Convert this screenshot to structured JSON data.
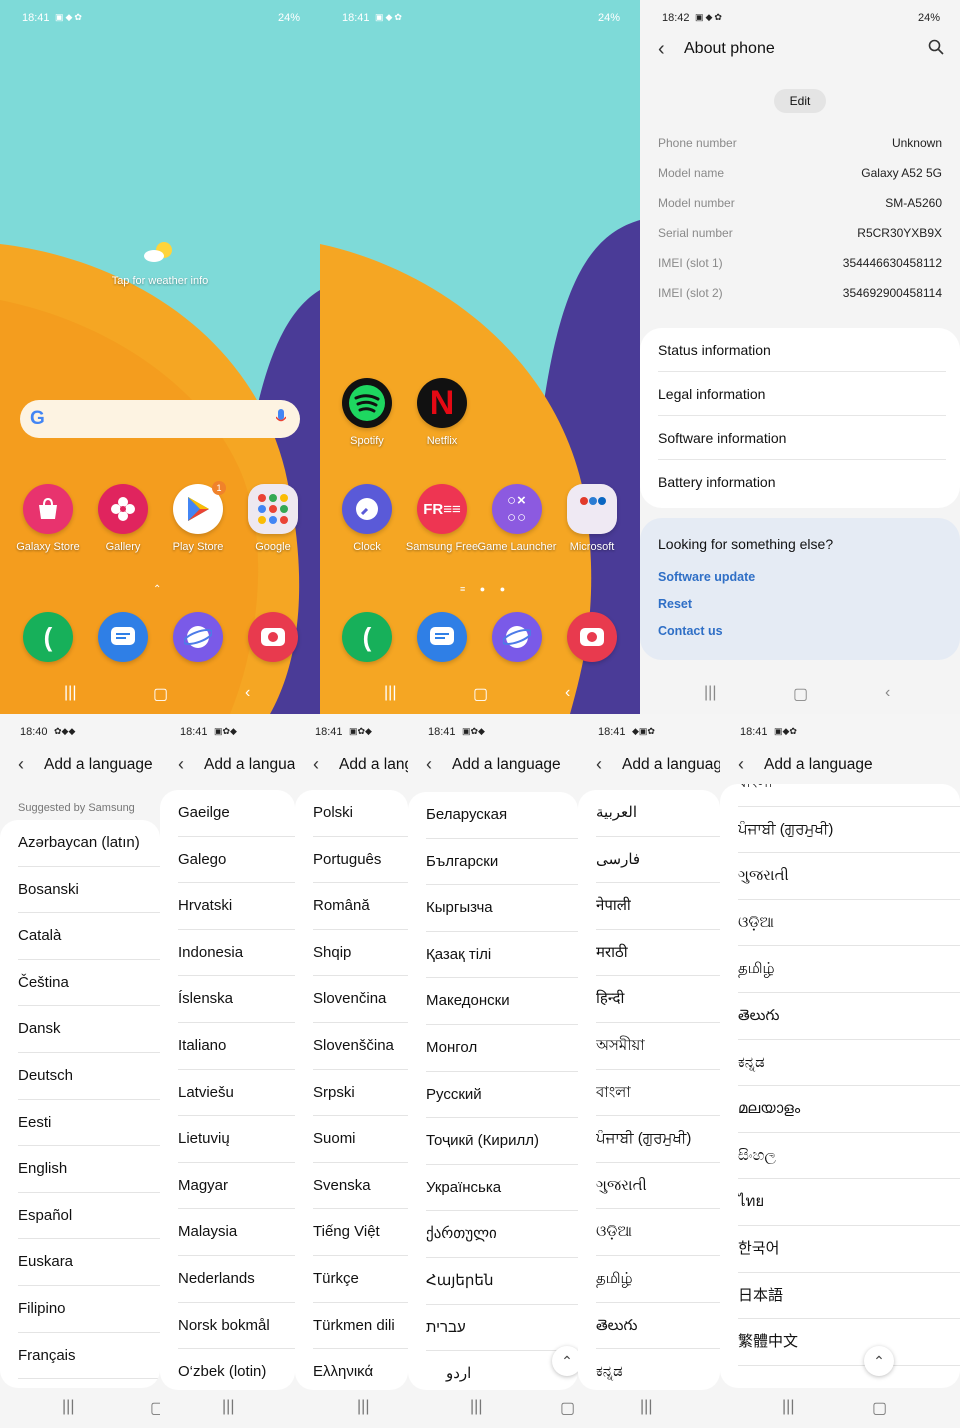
{
  "home1": {
    "time": "18:41",
    "battery": "24%",
    "weather_hint": "Tap for weather info",
    "apps": [
      "Galaxy Store",
      "Gallery",
      "Play Store",
      "Google"
    ],
    "play_badge": "1",
    "dock_icons": [
      "phone-icon",
      "messages-icon",
      "internet-icon",
      "camera-icon"
    ]
  },
  "home2": {
    "time": "18:41",
    "battery": "24%",
    "row1": [
      "Spotify",
      "Netflix"
    ],
    "row2": [
      "Clock",
      "Samsung Free",
      "Game Launcher",
      "Microsoft"
    ]
  },
  "about": {
    "time": "18:42",
    "battery": "24%",
    "title": "About phone",
    "edit": "Edit",
    "rows": [
      {
        "k": "Phone number",
        "v": "Unknown"
      },
      {
        "k": "Model name",
        "v": "Galaxy A52 5G"
      },
      {
        "k": "Model number",
        "v": "SM-A5260"
      },
      {
        "k": "Serial number",
        "v": "R5CR30YXB9X"
      },
      {
        "k": "IMEI (slot 1)",
        "v": "354446630458112"
      },
      {
        "k": "IMEI (slot 2)",
        "v": "354692900458114"
      }
    ],
    "menu": [
      "Status information",
      "Legal information",
      "Software information",
      "Battery information"
    ],
    "looking": "Looking for something else?",
    "links": [
      "Software update",
      "Reset",
      "Contact us"
    ]
  },
  "lang_title": "Add a language",
  "suggested": "Suggested by Samsung",
  "panels": [
    {
      "time": "18:40",
      "items": [
        "Azərbaycan (latın)",
        "Bosanski",
        "Català",
        "Čeština",
        "Dansk",
        "Deutsch",
        "Eesti",
        "English",
        "Español",
        "Euskara",
        "Filipino",
        "Français"
      ]
    },
    {
      "time": "18:41",
      "items": [
        "Gaeilge",
        "Galego",
        "Hrvatski",
        "Indonesia",
        "Íslenska",
        "Italiano",
        "Latviešu",
        "Lietuvių",
        "Magyar",
        "Malaysia",
        "Nederlands",
        "Norsk bokmål",
        "O‘zbek (lotin)"
      ]
    },
    {
      "time": "18:41",
      "items": [
        "Polski",
        "Português",
        "Română",
        "Shqip",
        "Slovenčina",
        "Slovenščina",
        "Srpski",
        "Suomi",
        "Svenska",
        "Tiếng Việt",
        "Türkçe",
        "Türkmen dili",
        "Ελληνικά"
      ]
    },
    {
      "time": "18:41",
      "items": [
        "Беларуская",
        "Български",
        "Кыргызча",
        "Қазақ тілі",
        "Македонски",
        "Монгол",
        "Русский",
        "Тоҷикӣ (Кирилл)",
        "Українська",
        "ქართული",
        "Հայերեն",
        "עברית",
        "اردو"
      ]
    },
    {
      "time": "18:41",
      "items": [
        "العربية",
        "فارسی",
        "नेपाली",
        "मराठी",
        "हिन्दी",
        "অসমীয়া",
        "বাংলা",
        "ਪੰਜਾਬੀ (ਗੁਰਮੁਖੀ)",
        "ગુજરાતી",
        "ଓଡ଼ିଆ",
        "தமிழ்",
        "తెలుగు",
        "ಕನ್ನಡ"
      ]
    },
    {
      "time": "18:41",
      "items": [
        "বাংলা",
        "ਪੰਜਾਬੀ (ਗੁਰਮੁਖੀ)",
        "ગુજરાતી",
        "ଓଡ଼ିଆ",
        "தமிழ்",
        "తెలుగు",
        "ಕನ್ನಡ",
        "മലയാളം",
        "සිංහල",
        "ไทย",
        "한국어",
        "日本語",
        "繁體中文"
      ]
    }
  ]
}
